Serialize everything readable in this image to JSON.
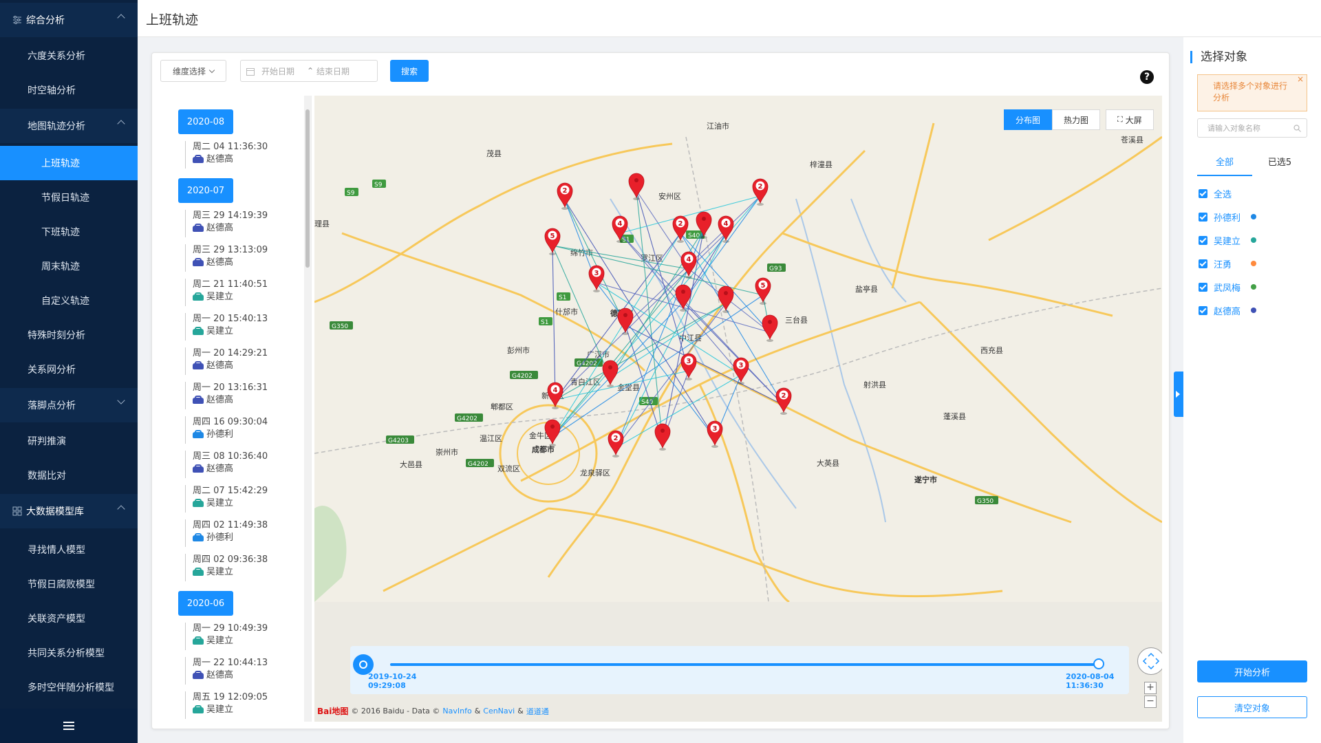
{
  "sidebar": {
    "items": [
      {
        "label": "综合分析",
        "kind": "group",
        "open": true
      },
      {
        "label": "六度关系分析",
        "kind": "sub"
      },
      {
        "label": "时空轴分析",
        "kind": "sub"
      },
      {
        "label": "地图轨迹分析",
        "kind": "sub",
        "open": true
      },
      {
        "label": "上班轨迹",
        "kind": "sub2",
        "active": true
      },
      {
        "label": "节假日轨迹",
        "kind": "sub2"
      },
      {
        "label": "下班轨迹",
        "kind": "sub2"
      },
      {
        "label": "周末轨迹",
        "kind": "sub2"
      },
      {
        "label": "自定义轨迹",
        "kind": "sub2"
      },
      {
        "label": "特殊时刻分析",
        "kind": "sub"
      },
      {
        "label": "关系网分析",
        "kind": "sub"
      },
      {
        "label": "落脚点分析",
        "kind": "sub",
        "open": false
      },
      {
        "label": "研判推演",
        "kind": "sub"
      },
      {
        "label": "数据比对",
        "kind": "sub"
      },
      {
        "label": "大数据模型库",
        "kind": "group",
        "open": true
      },
      {
        "label": "寻找情人模型",
        "kind": "sub"
      },
      {
        "label": "节假日腐败模型",
        "kind": "sub"
      },
      {
        "label": "关联资产模型",
        "kind": "sub"
      },
      {
        "label": "共同关系分析模型",
        "kind": "sub"
      },
      {
        "label": "多时空伴随分析模型",
        "kind": "sub"
      }
    ],
    "menu_icon": "hamburger-icon"
  },
  "header": {
    "title": "上班轨迹"
  },
  "toolbar": {
    "dimension_label": "维度选择",
    "start_placeholder": "开始日期",
    "end_placeholder": "结束日期",
    "search_label": "搜索",
    "help": "?"
  },
  "timeline_list": {
    "months": [
      {
        "label": "2020-08",
        "records": [
          {
            "time": "周二 04 11:36:30",
            "name": "赵德高",
            "color": "#3f51b5"
          }
        ]
      },
      {
        "label": "2020-07",
        "records": [
          {
            "time": "周三 29 14:19:39",
            "name": "赵德高",
            "color": "#3f51b5"
          },
          {
            "time": "周三 29 13:13:09",
            "name": "赵德高",
            "color": "#3f51b5"
          },
          {
            "time": "周二 21 11:40:51",
            "name": "吴建立",
            "color": "#26a69a"
          },
          {
            "time": "周一 20 15:40:13",
            "name": "吴建立",
            "color": "#26a69a"
          },
          {
            "time": "周一 20 14:29:21",
            "name": "赵德高",
            "color": "#3f51b5"
          },
          {
            "time": "周一 20 13:16:31",
            "name": "赵德高",
            "color": "#3f51b5"
          },
          {
            "time": "周四 16 09:30:04",
            "name": "孙德利",
            "color": "#1e88e5"
          },
          {
            "time": "周三 08 10:36:40",
            "name": "赵德高",
            "color": "#3f51b5"
          },
          {
            "time": "周二 07 15:42:29",
            "name": "吴建立",
            "color": "#26a69a"
          },
          {
            "time": "周四 02 11:49:38",
            "name": "孙德利",
            "color": "#1e88e5"
          },
          {
            "time": "周四 02 09:36:38",
            "name": "吴建立",
            "color": "#26a69a"
          }
        ]
      },
      {
        "label": "2020-06",
        "records": [
          {
            "time": "周一 29 10:49:39",
            "name": "吴建立",
            "color": "#26a69a"
          },
          {
            "time": "周一 22 10:44:13",
            "name": "赵德高",
            "color": "#3f51b5"
          },
          {
            "time": "周五 19 12:09:05",
            "name": "吴建立",
            "color": "#26a69a"
          }
        ]
      }
    ]
  },
  "map": {
    "tabs": [
      "分布图",
      "热力图"
    ],
    "active_tab": "分布图",
    "fullscreen_label": "大屏",
    "place_labels": [
      "江油市",
      "茂县",
      "梓潼县",
      "苍溪县",
      "安州区",
      "理县",
      "绵竹市",
      "罗江区",
      "盐亭县",
      "什邡市",
      "德阳市",
      "三台县",
      "中江县",
      "彭州市",
      "西充县",
      "广汉市",
      "青白江区",
      "金堂县",
      "射洪县",
      "新都区",
      "郫都区",
      "蓬溪县",
      "温江区",
      "金牛区",
      "成都市",
      "崇州市",
      "大邑县",
      "双流区",
      "龙泉驿区",
      "大英县",
      "遂宁市"
    ],
    "road_badges": [
      "S9",
      "S9",
      "S1",
      "S40",
      "G93",
      "S1",
      "S1",
      "G350",
      "G4202",
      "G4202",
      "G4202",
      "G4203",
      "G4202",
      "S40",
      "G350"
    ],
    "markers": [
      {
        "count": "2"
      },
      {
        "count": ""
      },
      {
        "count": "2"
      },
      {
        "count": "5"
      },
      {
        "count": "4"
      },
      {
        "count": "2"
      },
      {
        "count": ""
      },
      {
        "count": "4"
      },
      {
        "count": "3"
      },
      {
        "count": "4"
      },
      {
        "count": ""
      },
      {
        "count": ""
      },
      {
        "count": "5"
      },
      {
        "count": ""
      },
      {
        "count": ""
      },
      {
        "count": "3"
      },
      {
        "count": "3"
      },
      {
        "count": ""
      },
      {
        "count": "4"
      },
      {
        "count": "2"
      },
      {
        "count": ""
      },
      {
        "count": "2"
      },
      {
        "count": ""
      },
      {
        "count": "3"
      }
    ],
    "copyright": "© 2016 Baidu - Data ©",
    "copyright_links": [
      "NavInfo",
      "&",
      "CenNavi",
      "&",
      "道道通"
    ],
    "baidu_logo": "Bai地图"
  },
  "timeline": {
    "start_date": "2019-10-24",
    "start_time": "09:29:08",
    "end_date": "2020-08-04",
    "end_time": "11:36:30",
    "progress": 1.0
  },
  "right_panel": {
    "title": "选择对象",
    "warning": "请选择多个对象进行分析",
    "search_placeholder": "请输入对象名称",
    "tabs": [
      "全部",
      "已选5"
    ],
    "select_all": "全选",
    "objects": [
      {
        "name": "孙德利",
        "color": "#1e88e5"
      },
      {
        "name": "吴建立",
        "color": "#26a69a"
      },
      {
        "name": "汪勇",
        "color": "#ff8a3d"
      },
      {
        "name": "武凤梅",
        "color": "#43a047"
      },
      {
        "name": "赵德高",
        "color": "#3f51b5"
      }
    ],
    "start_label": "开始分析",
    "clear_label": "清空对象"
  }
}
